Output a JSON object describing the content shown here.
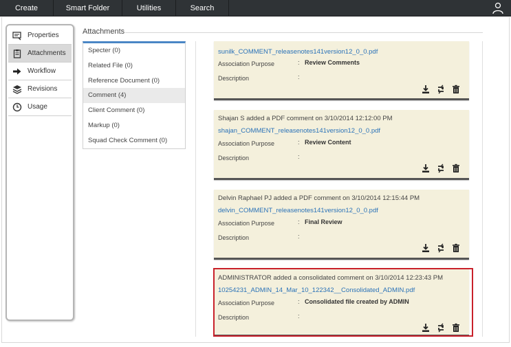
{
  "topnav": {
    "items": [
      {
        "label": "Create"
      },
      {
        "label": "Smart Folder"
      },
      {
        "label": "Utilities"
      },
      {
        "label": "Search"
      }
    ],
    "user_icon": "user-icon"
  },
  "sidebar": {
    "items": [
      {
        "label": "Properties",
        "icon": "properties-icon",
        "active": false
      },
      {
        "label": "Attachments",
        "icon": "clipboard-icon",
        "active": true
      },
      {
        "label": "Workflow",
        "icon": "arrow-right-icon",
        "active": false
      },
      {
        "label": "Revisions",
        "icon": "stack-icon",
        "active": false
      },
      {
        "label": "Usage",
        "icon": "clock-icon",
        "active": false
      }
    ]
  },
  "section": {
    "title": "Attachments"
  },
  "categories": [
    {
      "label": "Specter (0)",
      "active": false
    },
    {
      "label": "Related File (0)",
      "active": false
    },
    {
      "label": "Reference Document (0)",
      "active": false
    },
    {
      "label": "Comment (4)",
      "active": true
    },
    {
      "label": "Client Comment (0)",
      "active": false
    },
    {
      "label": "Markup (0)",
      "active": false
    },
    {
      "label": "Squad Check Comment (0)",
      "active": false
    }
  ],
  "cards": [
    {
      "header": "",
      "file": "sunilk_COMMENT_releasenotes141version12_0_0.pdf",
      "purpose_label": "Association Purpose",
      "purpose_value": "Review Comments",
      "description_label": "Description",
      "description_value": ""
    },
    {
      "header": "Shajan S added a PDF comment on 3/10/2014 12:12:00 PM",
      "file": "shajan_COMMENT_releasenotes141version12_0_0.pdf",
      "purpose_label": "Association Purpose",
      "purpose_value": "Review Content",
      "description_label": "Description",
      "description_value": ""
    },
    {
      "header": "Delvin Raphael PJ added a PDF comment on 3/10/2014 12:15:44 PM",
      "file": "delvin_COMMENT_releasenotes141version12_0_0.pdf",
      "purpose_label": "Association Purpose",
      "purpose_value": "Final Review",
      "description_label": "Description",
      "description_value": ""
    },
    {
      "header": "ADMINISTRATOR added a consolidated comment on 3/10/2014 12:23:43 PM",
      "file": "10254231_ADMIN_14_Mar_10_122342__Consolidated_ADMIN.pdf",
      "purpose_label": "Association Purpose",
      "purpose_value": "Consolidated file created by ADMIN",
      "description_label": "Description",
      "description_value": ""
    }
  ],
  "colors": {
    "topbar": "#2f3336",
    "card_bg": "#f4f0dc",
    "link": "#2a72b8",
    "highlight": "#c8202a",
    "list_accent": "#4a86c5"
  }
}
